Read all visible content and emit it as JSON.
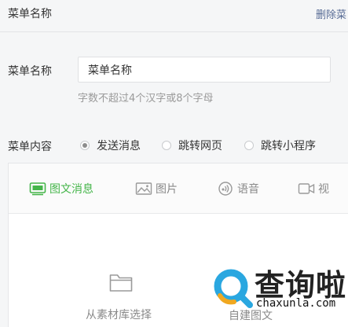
{
  "header": {
    "title": "菜单名称",
    "delete_label": "删除菜"
  },
  "name_field": {
    "label": "菜单名称",
    "value": "菜单名称",
    "hint": "字数不超过4个汉字或8个字母"
  },
  "content": {
    "label": "菜单内容",
    "options": [
      {
        "label": "发送消息",
        "checked": true
      },
      {
        "label": "跳转网页",
        "checked": false
      },
      {
        "label": "跳转小程序",
        "checked": false
      }
    ]
  },
  "tabs": [
    {
      "label": "图文消息",
      "icon": "news-icon",
      "active": true
    },
    {
      "label": "图片",
      "icon": "image-icon",
      "active": false
    },
    {
      "label": "语音",
      "icon": "audio-icon",
      "active": false
    },
    {
      "label": "视",
      "icon": "video-icon",
      "active": false
    }
  ],
  "material_picker": {
    "label": "从素材库选择",
    "icon": "folder-icon"
  },
  "create_news": {
    "label": "自建图文"
  },
  "watermark": {
    "text": "查询啦",
    "url": "chaxunla.com",
    "brand_color": "#2aa7e0",
    "accent_color": "#f0a820"
  },
  "colors": {
    "accent_green": "#44b549",
    "link_blue": "#576b95"
  }
}
